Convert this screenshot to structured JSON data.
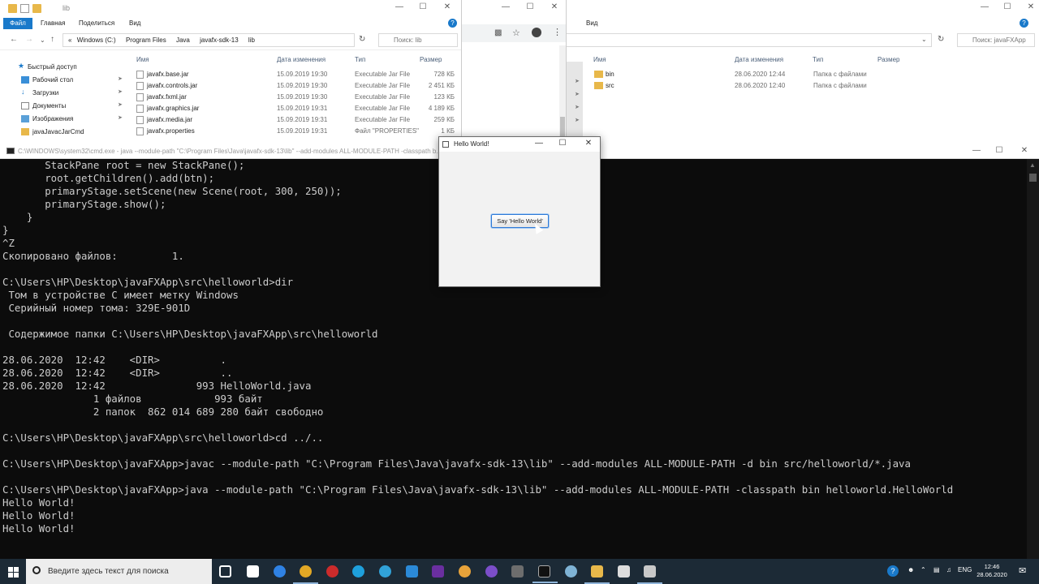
{
  "explorer_left": {
    "title": "lib",
    "ribbon_tabs": [
      "Файл",
      "Главная",
      "Поделиться",
      "Вид"
    ],
    "breadcrumb": [
      "Windows (C:)",
      "Program Files",
      "Java",
      "javafx-sdk-13",
      "lib"
    ],
    "search_placeholder": "Поиск: lib",
    "columns": {
      "name": "Имя",
      "date": "Дата изменения",
      "type": "Тип",
      "size": "Размер"
    },
    "nav_items": [
      {
        "label": "Быстрый доступ",
        "pinned": false
      },
      {
        "label": "Рабочий стол",
        "pinned": true
      },
      {
        "label": "Загрузки",
        "pinned": true
      },
      {
        "label": "Документы",
        "pinned": true
      },
      {
        "label": "Изображения",
        "pinned": true
      },
      {
        "label": "javaJavacJarCmd",
        "pinned": false
      }
    ],
    "files": [
      {
        "name": "javafx.base.jar",
        "date": "15.09.2019 19:30",
        "type": "Executable Jar File",
        "size": "728 КБ"
      },
      {
        "name": "javafx.controls.jar",
        "date": "15.09.2019 19:30",
        "type": "Executable Jar File",
        "size": "2 451 КБ"
      },
      {
        "name": "javafx.fxml.jar",
        "date": "15.09.2019 19:30",
        "type": "Executable Jar File",
        "size": "123 КБ"
      },
      {
        "name": "javafx.graphics.jar",
        "date": "15.09.2019 19:31",
        "type": "Executable Jar File",
        "size": "4 189 КБ"
      },
      {
        "name": "javafx.media.jar",
        "date": "15.09.2019 19:31",
        "type": "Executable Jar File",
        "size": "259 КБ"
      },
      {
        "name": "javafx.properties",
        "date": "15.09.2019 19:31",
        "type": "Файл \"PROPERTIES\"",
        "size": "1 КБ"
      }
    ]
  },
  "explorer_right": {
    "ribbon_tab": "Вид",
    "search_placeholder": "Поиск: javaFXApp",
    "columns": {
      "name": "Имя",
      "date": "Дата изменения",
      "type": "Тип",
      "size": "Размер"
    },
    "files": [
      {
        "name": "bin",
        "date": "28.06.2020 12:44",
        "type": "Папка с файлами"
      },
      {
        "name": "src",
        "date": "28.06.2020 12:40",
        "type": "Папка с файлами"
      }
    ]
  },
  "cmd": {
    "title": "C:\\WINDOWS\\system32\\cmd.exe - java --module-path \"C:\\Program Files\\Java\\javafx-sdk-13\\lib\" --add-modules ALL-MODULE-PATH -classpath b...",
    "lines": [
      "       StackPane root = new StackPane();",
      "       root.getChildren().add(btn);",
      "       primaryStage.setScene(new Scene(root, 300, 250));",
      "       primaryStage.show();",
      "    }",
      "}",
      "^Z",
      "Скопировано файлов:         1.",
      "",
      "C:\\Users\\HP\\Desktop\\javaFXApp\\src\\helloworld>dir",
      " Том в устройстве C имеет метку Windows",
      " Серийный номер тома: 329E-901D",
      "",
      " Содержимое папки C:\\Users\\HP\\Desktop\\javaFXApp\\src\\helloworld",
      "",
      "28.06.2020  12:42    <DIR>          .",
      "28.06.2020  12:42    <DIR>          ..",
      "28.06.2020  12:42               993 HelloWorld.java",
      "               1 файлов            993 байт",
      "               2 папок  862 014 689 280 байт свободно",
      "",
      "C:\\Users\\HP\\Desktop\\javaFXApp\\src\\helloworld>cd ../..",
      "",
      "C:\\Users\\HP\\Desktop\\javaFXApp>javac --module-path \"C:\\Program Files\\Java\\javafx-sdk-13\\lib\" --add-modules ALL-MODULE-PATH -d bin src/helloworld/*.java",
      "",
      "C:\\Users\\HP\\Desktop\\javaFXApp>java --module-path \"C:\\Program Files\\Java\\javafx-sdk-13\\lib\" --add-modules ALL-MODULE-PATH -classpath bin helloworld.HelloWorld",
      "Hello World!",
      "Hello World!",
      "Hello World!"
    ]
  },
  "hello_window": {
    "title": "Hello World!",
    "button_label": "Say 'Hello World'"
  },
  "taskbar": {
    "search_placeholder": "Введите здесь текст для поиска",
    "language": "ENG",
    "time": "12:46",
    "date": "28.06.2020"
  },
  "colors": {
    "accent": "#1979ca",
    "console_bg": "#0c0c0c",
    "console_fg": "#cccccc",
    "taskbar_bg": "#1c2a36",
    "folder": "#e8b84a"
  }
}
